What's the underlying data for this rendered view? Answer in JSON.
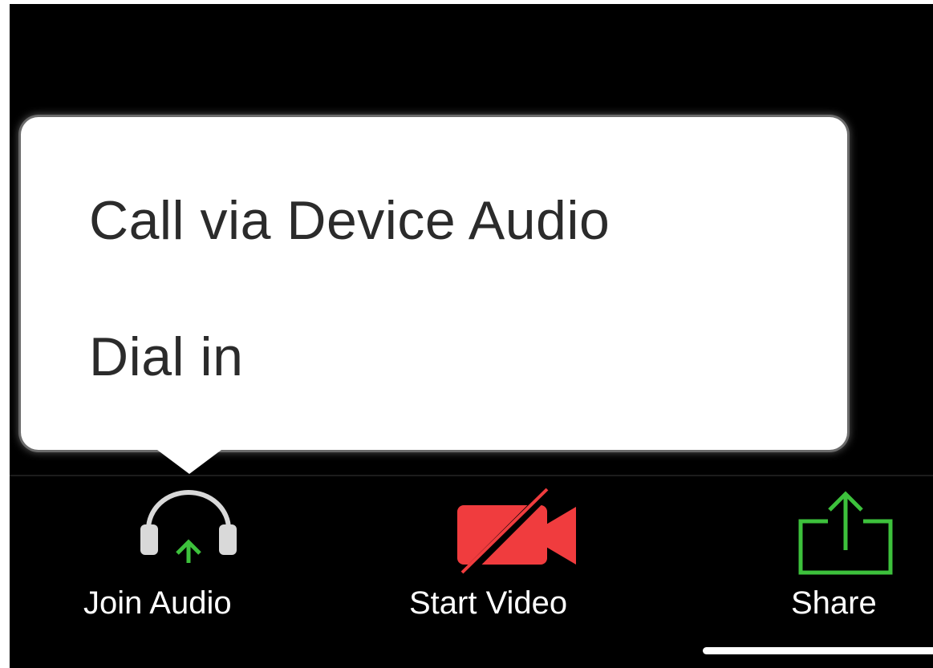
{
  "audio_menu": {
    "items": [
      {
        "label": "Call via Device Audio"
      },
      {
        "label": "Dial in"
      }
    ]
  },
  "toolbar": {
    "join_audio": {
      "label": "Join Audio",
      "icon": "headphones-icon",
      "accent": "#3dc13c"
    },
    "start_video": {
      "label": "Start Video",
      "icon": "video-off-icon",
      "accent": "#f03c3e"
    },
    "share": {
      "label": "Share",
      "icon": "share-icon",
      "accent": "#3dc13c"
    }
  },
  "colors": {
    "background": "#000000",
    "menu_background": "#ffffff",
    "menu_text": "#2b2b2b",
    "toolbar_text": "#ffffff",
    "green": "#3dc13c",
    "red": "#f03c3e"
  }
}
